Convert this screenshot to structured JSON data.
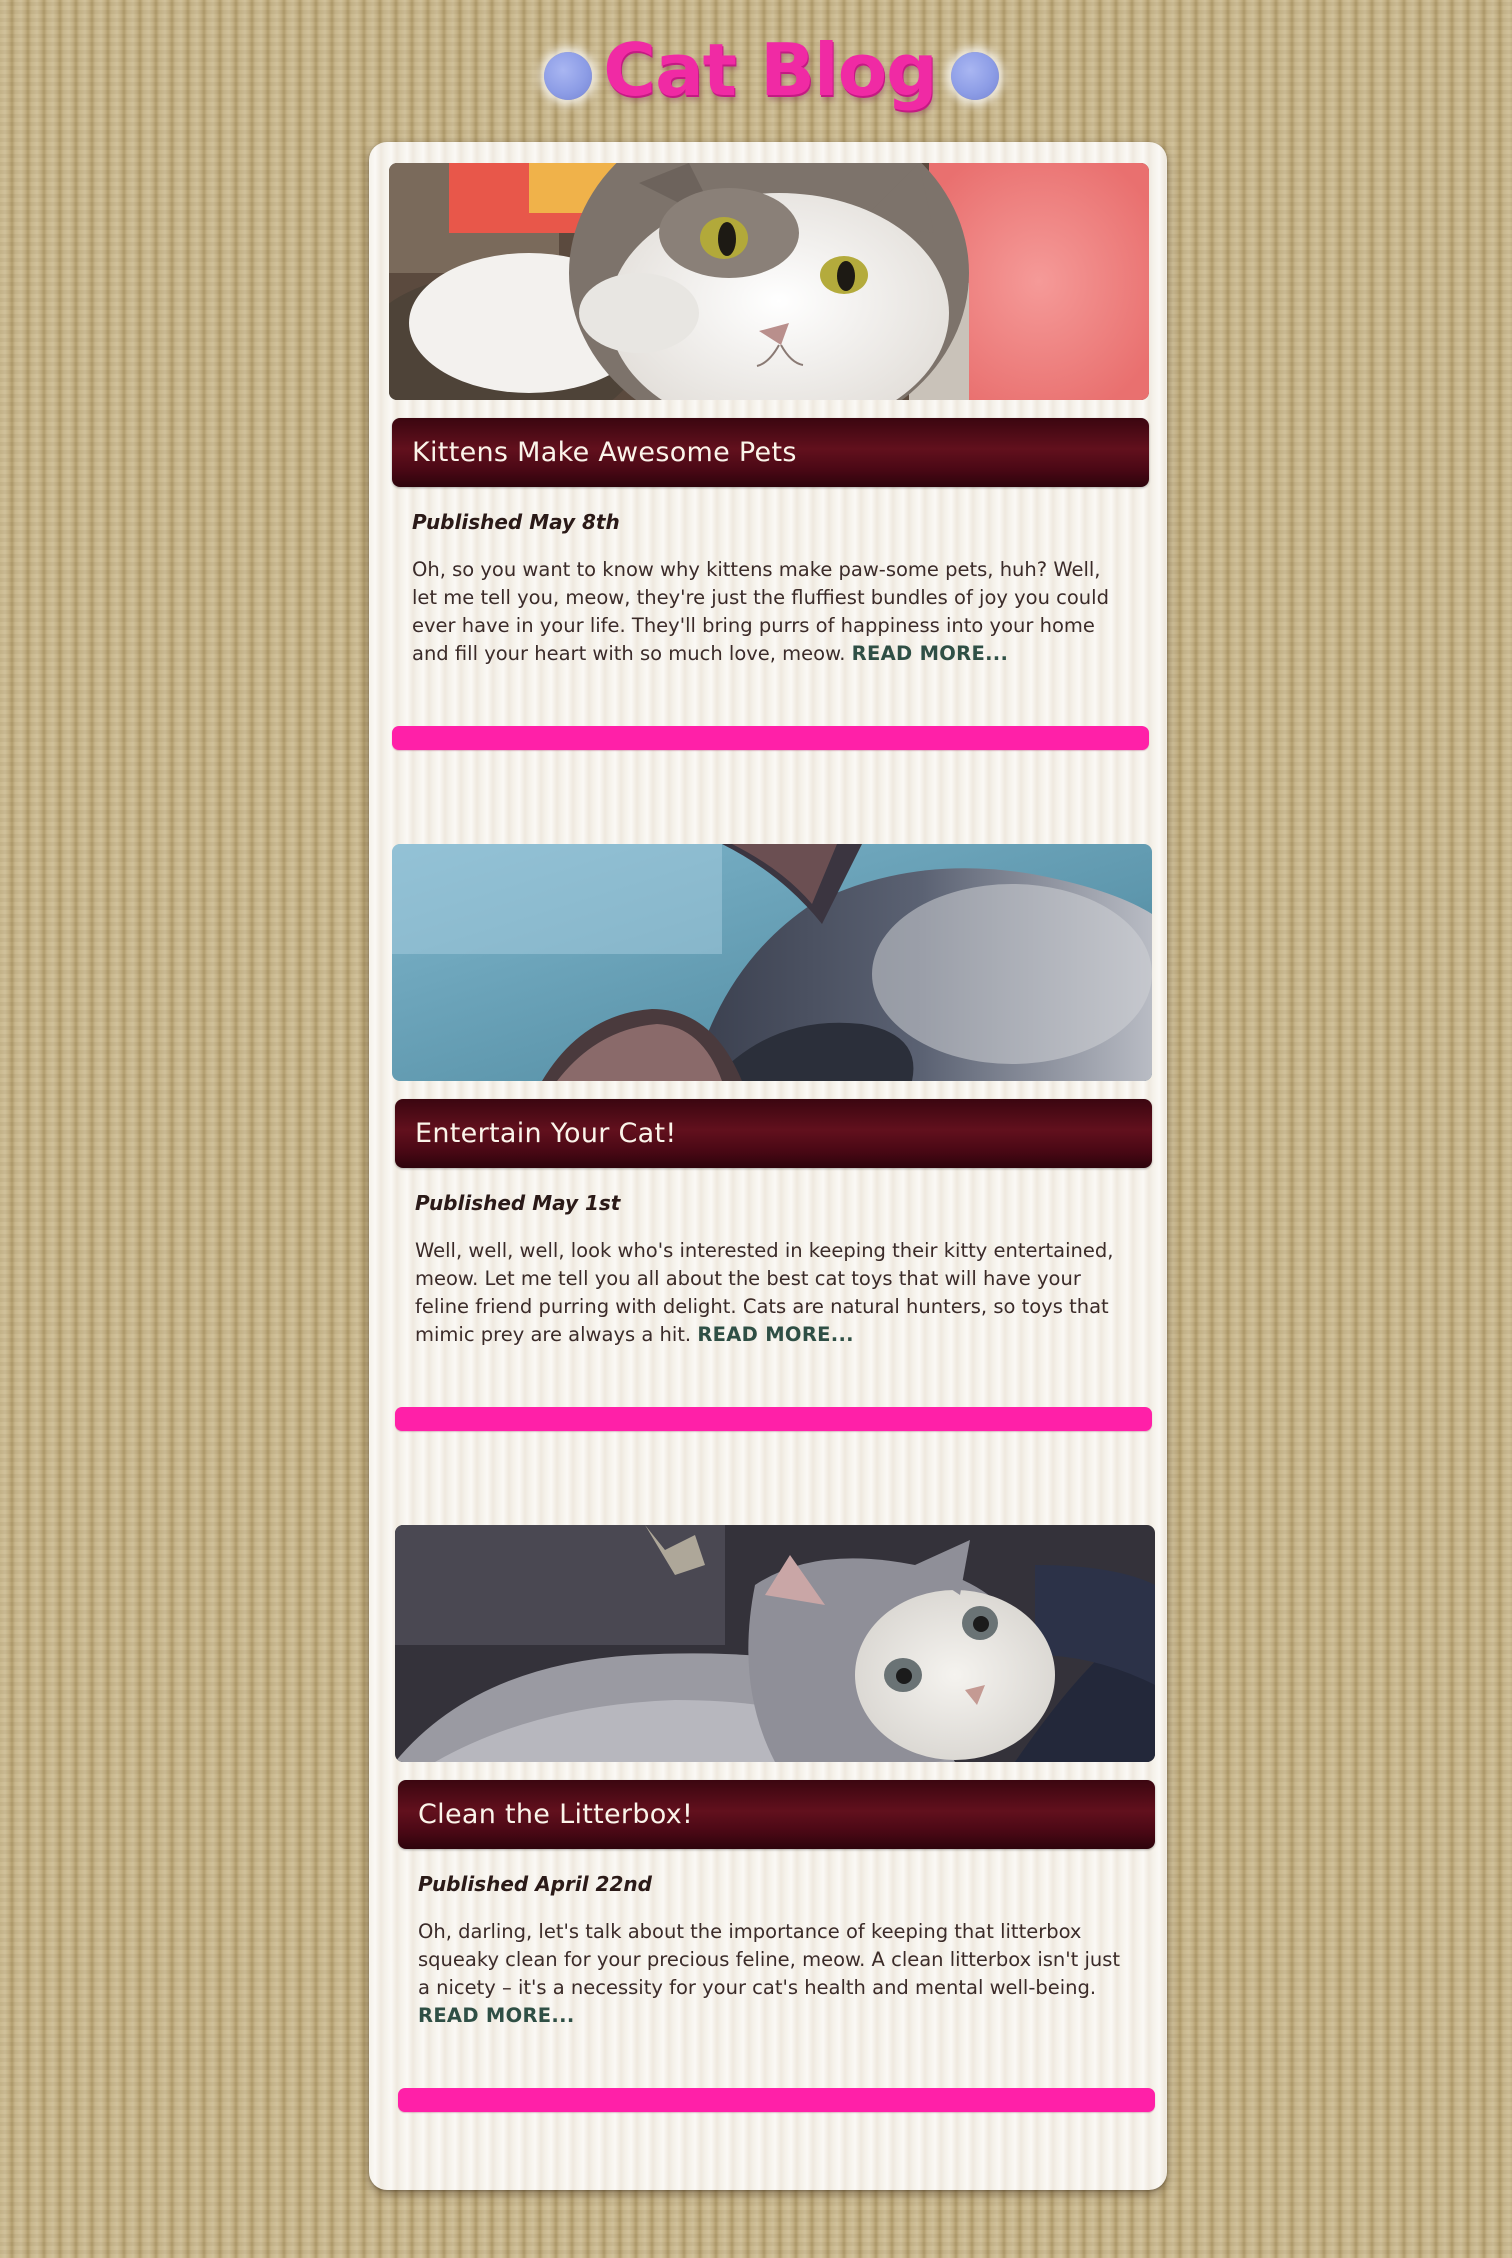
{
  "site": {
    "title": "Cat Blog"
  },
  "colors": {
    "title": "#f02aa4",
    "title_bar": "#5a0d1a",
    "divider": "#ff20a8",
    "read_more": "#2f4f45",
    "orb": "#8d9de6"
  },
  "posts": [
    {
      "image_alt": "kitten-photo-white-and-grey-cat",
      "title": "Kittens Make Awesome Pets",
      "date": "Published May 8th",
      "excerpt": "Oh, so you want to know why kittens make paw-some pets, huh? Well, let me tell you, meow, they're just the fluffiest bundles of joy you could ever have in your life. They'll bring purrs of happiness into your home and fill your heart with so much love, meow.",
      "read_more": "READ MORE..."
    },
    {
      "image_alt": "kitten-photo-grey-cat-ears",
      "title": "Entertain Your Cat!",
      "date": "Published May 1st",
      "excerpt": "Well, well, well, look who's interested in keeping their kitty entertained, meow. Let me tell you all about the best cat toys that will have your feline friend purring with delight. Cats are natural hunters, so toys that mimic prey are always a hit.",
      "read_more": "READ MORE..."
    },
    {
      "image_alt": "kitten-photo-grey-and-white-kitten",
      "title": "Clean the Litterbox!",
      "date": "Published April 22nd",
      "excerpt": "Oh, darling, let's talk about the importance of keeping that litterbox squeaky clean for your precious feline, meow. A clean litterbox isn't just a nicety – it's a necessity for your cat's health and mental well-being.",
      "read_more": "READ MORE..."
    }
  ]
}
